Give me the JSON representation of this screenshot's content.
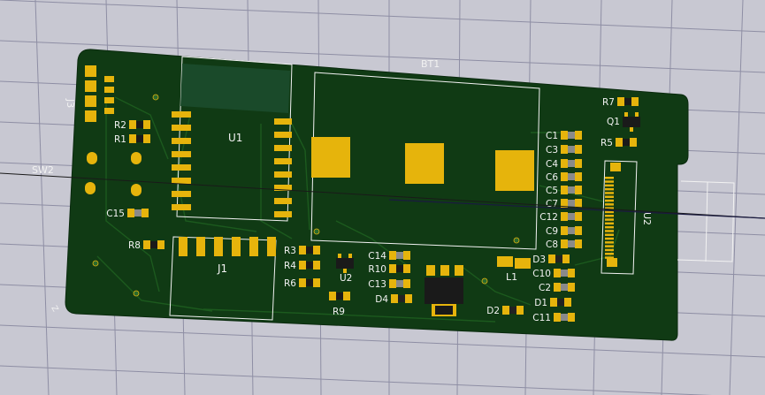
{
  "viewer": {
    "background": "#c8c8d2",
    "grid_color": "#8e8ea4",
    "board_color": "#103a14",
    "trace_color": "#1c5a1e",
    "pad_color": "#e6b40c",
    "silk_color": "#f2f2f2"
  },
  "silkscreen": {
    "bt1": "BT1",
    "u1": "U1",
    "j1": "J1",
    "j3": "J3",
    "j2": "J2",
    "u2_right": "U2",
    "sw2": "SW2",
    "l1": "L1"
  },
  "components": [
    {
      "ref": "R2",
      "type": "resistor"
    },
    {
      "ref": "R1",
      "type": "resistor"
    },
    {
      "ref": "C15",
      "type": "capacitor"
    },
    {
      "ref": "R8",
      "type": "resistor"
    },
    {
      "ref": "R3",
      "type": "resistor"
    },
    {
      "ref": "R4",
      "type": "resistor"
    },
    {
      "ref": "R6",
      "type": "resistor"
    },
    {
      "ref": "U2",
      "type": "ic"
    },
    {
      "ref": "R9",
      "type": "resistor"
    },
    {
      "ref": "C14",
      "type": "capacitor"
    },
    {
      "ref": "R10",
      "type": "resistor"
    },
    {
      "ref": "C13",
      "type": "capacitor"
    },
    {
      "ref": "D4",
      "type": "diode"
    },
    {
      "ref": "D2",
      "type": "diode"
    },
    {
      "ref": "R7",
      "type": "resistor"
    },
    {
      "ref": "Q1",
      "type": "transistor"
    },
    {
      "ref": "R5",
      "type": "resistor"
    },
    {
      "ref": "C1",
      "type": "capacitor"
    },
    {
      "ref": "C3",
      "type": "capacitor"
    },
    {
      "ref": "C4",
      "type": "capacitor"
    },
    {
      "ref": "C6",
      "type": "capacitor"
    },
    {
      "ref": "C5",
      "type": "capacitor"
    },
    {
      "ref": "C7",
      "type": "capacitor"
    },
    {
      "ref": "C12",
      "type": "capacitor"
    },
    {
      "ref": "C9",
      "type": "capacitor"
    },
    {
      "ref": "C8",
      "type": "capacitor"
    },
    {
      "ref": "D3",
      "type": "diode"
    },
    {
      "ref": "C10",
      "type": "capacitor"
    },
    {
      "ref": "C2",
      "type": "capacitor"
    },
    {
      "ref": "D1",
      "type": "diode"
    },
    {
      "ref": "C11",
      "type": "capacitor"
    }
  ]
}
